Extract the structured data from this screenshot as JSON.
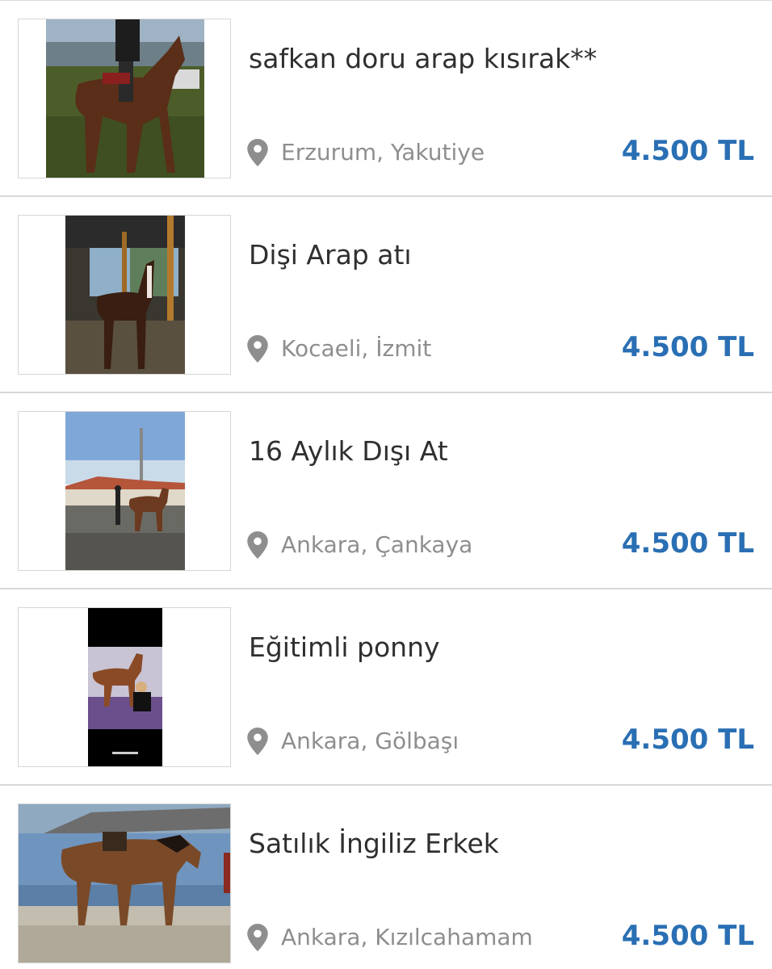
{
  "listings": [
    {
      "title": "safkan doru arap kısırak**",
      "location": "Erzurum, Yakutiye",
      "price": "4.500 TL"
    },
    {
      "title": "Dişi Arap atı",
      "location": "Kocaeli, İzmit",
      "price": "4.500 TL"
    },
    {
      "title": "16 Aylık Dışı At",
      "location": "Ankara, Çankaya",
      "price": "4.500 TL"
    },
    {
      "title": "Eğitimli ponny",
      "location": "Ankara, Gölbaşı",
      "price": "4.500 TL"
    },
    {
      "title": "Satılık İngiliz Erkek",
      "location": "Ankara, Kızılcahamam",
      "price": "4.500 TL"
    }
  ],
  "icons": {
    "location": "location-pin-icon"
  },
  "colors": {
    "price": "#2a6fb4",
    "location_text": "#8e8e8e",
    "title_text": "#2f2f2f",
    "divider": "#d8d8d8"
  }
}
